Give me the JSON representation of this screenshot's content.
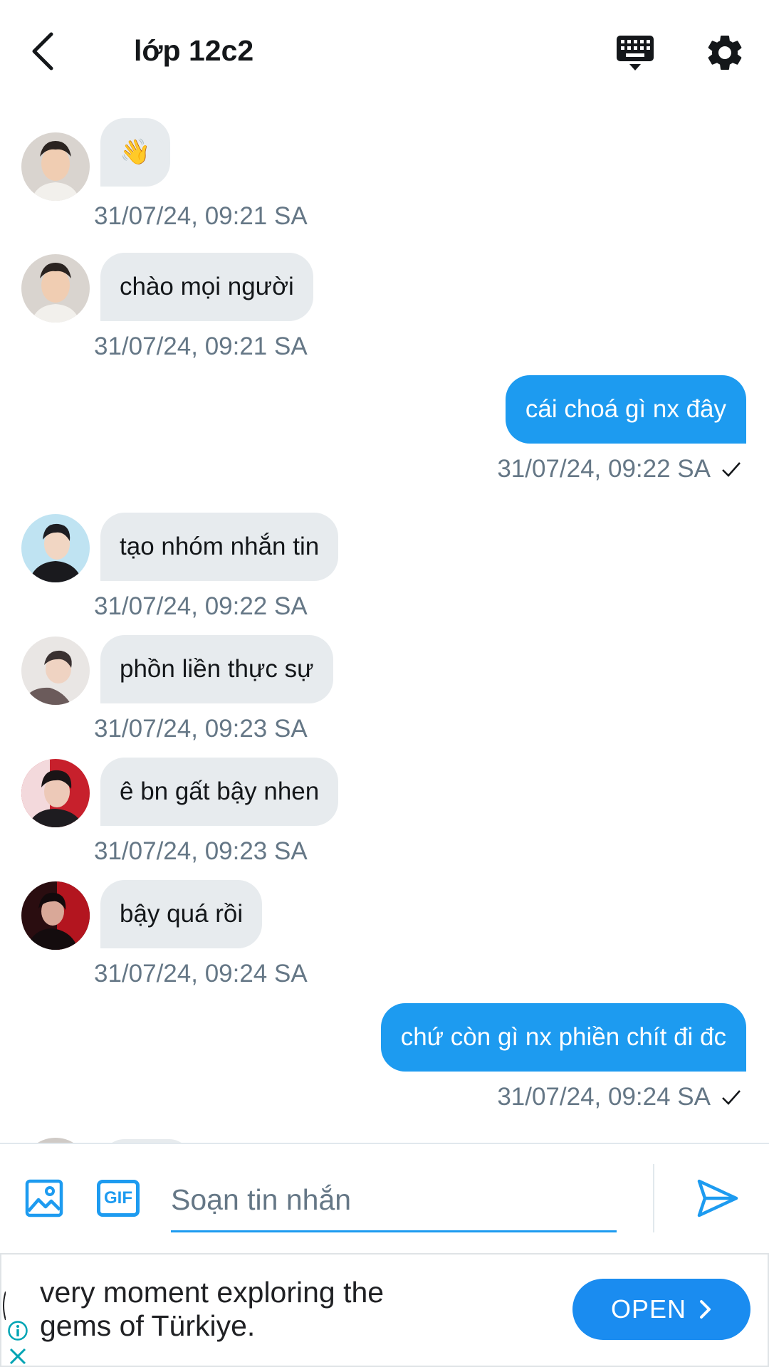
{
  "header": {
    "title": "lớp 12c2"
  },
  "messages": [
    {
      "dir": "in",
      "text": "👋",
      "time": "31/07/24, 09:21 SA",
      "avatar": "avatar-boy-light"
    },
    {
      "dir": "in",
      "text": "chào mọi người",
      "time": "31/07/24, 09:21 SA",
      "avatar": "avatar-boy-light"
    },
    {
      "dir": "out",
      "text": "cái choá gì nx đây",
      "time": "31/07/24, 09:22 SA"
    },
    {
      "dir": "in",
      "text": "tạo nhóm nhắn tin",
      "time": "31/07/24, 09:22 SA",
      "avatar": "avatar-boy-blue"
    },
    {
      "dir": "in",
      "text": "phồn liền thực sự",
      "time": "31/07/24, 09:23 SA",
      "avatar": "avatar-boy-lying"
    },
    {
      "dir": "in",
      "text": "ê bn gất bậy nhen",
      "time": "31/07/24, 09:23 SA",
      "avatar": "avatar-boy-red"
    },
    {
      "dir": "in",
      "text": "bậy quá rồi",
      "time": "31/07/24, 09:24 SA",
      "avatar": "avatar-boy-dark"
    },
    {
      "dir": "out",
      "text": "chứ còn gì nx phiền chít đi đc",
      "time": "31/07/24, 09:24 SA"
    }
  ],
  "composer": {
    "placeholder": "Soạn tin nhắn",
    "gif_label": "GIF"
  },
  "ad": {
    "line1": "very moment exploring the",
    "line2": "gems of Türkiye.",
    "cta": "OPEN"
  },
  "colors": {
    "accent": "#1d9bf0",
    "incoming_bubble": "#e7ebee",
    "timestamp": "#657786"
  }
}
